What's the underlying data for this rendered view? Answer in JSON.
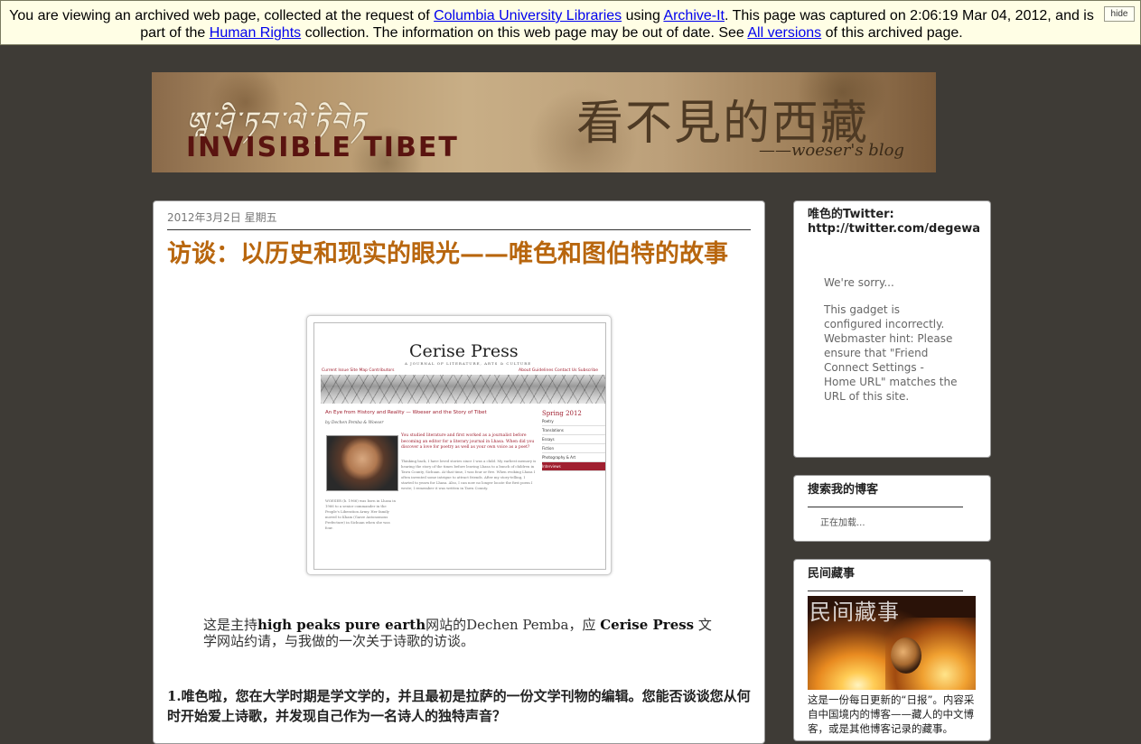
{
  "archive_banner": {
    "t1": "You are viewing an archived web page, collected at the request of ",
    "l1": "Columbia University Libraries",
    "t2": " using ",
    "l2": "Archive-It",
    "t3": ". This page was captured on 2:06:19 Mar 04, 2012, and is part of the ",
    "l3": "Human Rights",
    "t4": " collection. The information on this web page may be out of date. See ",
    "l4": "All versions",
    "t5": " of this archived page.",
    "hide_label": "hide"
  },
  "header": {
    "tibetan_script": "ཨཱ་ཤི་ཏབ་ལེ་ཏིབེཏ",
    "english_title": "INVISIBLE TIBET",
    "chinese_title": "看不見的西藏",
    "signature": "——woeser's blog"
  },
  "post": {
    "date": "2012年3月2日 星期五",
    "title": "访谈：以历史和现实的眼光——唯色和图伯特的故事",
    "image": {
      "site_name": "Cerise Press",
      "tagline": "A JOURNAL OF LITERATURE, ARTS & CULTURE",
      "nav_left": "Current Issue   Site Map   Contributors",
      "nav_right": "About   Guidelines   Contact Us   Subscribe",
      "article_title": "An Eye from History and Reality — Woeser and the Story of Tibet",
      "byline": "by Dechen Pemba & Woeser",
      "question": "You studied literature and first worked as a journalist before becoming an editor for a literary journal in Lhasa. When did you discover a love for poetry as well as your own voice as a poet?",
      "body": "Thinking back, I have loved stories since I was a child. My earliest memory is hearing the story of the times before leaving Lhasa to a bunch of children in Tawu County, Sichuan. At that time, I was four or five. When evoking Lhasa I often invented some intrigue to attract friends. After my story-telling, I started to yearn for Lhasa. Also, I can now no longer locate the first poem I wrote; I remember it was written in Tawu County.",
      "bio": "WOESER (b. 1966) was born in Lhasa in 1966 to a senior commander in the People's Liberation Army. Her family moved to Kham (Garze Autonomous Prefecture) in Sichuan when she was four.",
      "sidebar_issue": "Spring 2012",
      "sidebar_items": [
        "Poetry",
        "Translations",
        "Essays",
        "Fiction",
        "Photography & Art",
        "Interviews"
      ]
    },
    "intro": {
      "p1": "这是主持",
      "b1": "high peaks pure earth",
      "p2": "网站的Dechen Pemba，应 ",
      "b2": "Cerise Press",
      "p3": " 文学网站约请，与我做的一次关于诗歌的访谈。"
    },
    "question1": "1.唯色啦，您在大学时期是学文学的，并且最初是拉萨的一份文学刊物的编辑。您能否谈谈您从何时开始爱上诗歌，并发现自己作为一名诗人的独特声音？"
  },
  "sidebar": {
    "twitter": {
      "title": "唯色的Twitter: http://twitter.com/degewa",
      "sorry": "We're sorry...",
      "message": "This gadget is configured incorrectly. Webmaster hint: Please ensure that \"Friend Connect Settings - Home URL\" matches the URL of this site."
    },
    "search": {
      "title": "搜索我的博客",
      "loading": "正在加载..."
    },
    "minjian": {
      "title": "民间藏事",
      "image_overlay": "民间藏事",
      "desc": "这是一份每日更新的“日报”。内容采自中国境内的博客——藏人的中文博客，或是其他博客记录的藏事。"
    }
  }
}
